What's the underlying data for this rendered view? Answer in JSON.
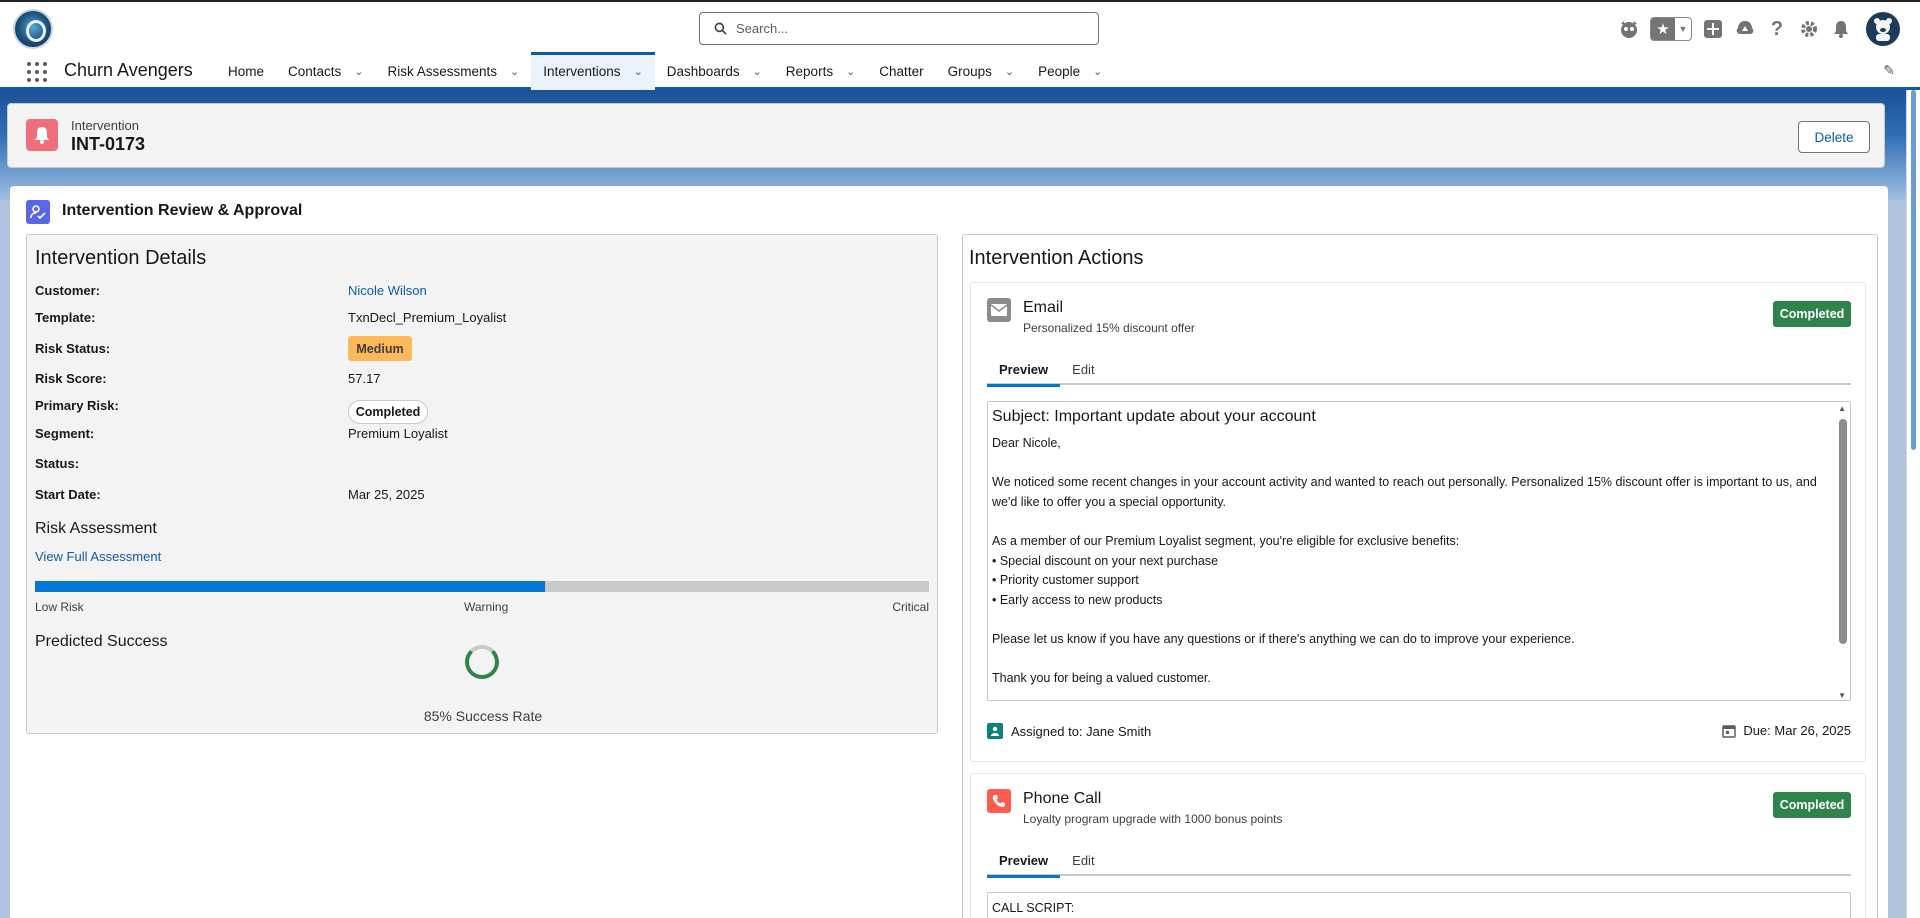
{
  "header": {
    "search_placeholder": "Search...",
    "icons": [
      "bot-icon",
      "favorites-star-icon",
      "add-icon",
      "trailhead-icon",
      "help-icon",
      "setup-gear-icon",
      "notifications-bell-icon",
      "avatar"
    ]
  },
  "nav": {
    "app_name": "Churn Avengers",
    "items": [
      {
        "label": "Home",
        "dropdown": false,
        "active": false
      },
      {
        "label": "Contacts",
        "dropdown": true,
        "active": false
      },
      {
        "label": "Risk Assessments",
        "dropdown": true,
        "active": false
      },
      {
        "label": "Interventions",
        "dropdown": true,
        "active": true
      },
      {
        "label": "Dashboards",
        "dropdown": true,
        "active": false
      },
      {
        "label": "Reports",
        "dropdown": true,
        "active": false
      },
      {
        "label": "Chatter",
        "dropdown": false,
        "active": false
      },
      {
        "label": "Groups",
        "dropdown": true,
        "active": false
      },
      {
        "label": "People",
        "dropdown": true,
        "active": false
      }
    ]
  },
  "record": {
    "type_label": "Intervention",
    "name": "INT-0173",
    "delete_label": "Delete"
  },
  "main": {
    "title": "Intervention Review & Approval"
  },
  "details": {
    "heading": "Intervention Details",
    "fields": {
      "customer_label": "Customer:",
      "customer_value": "Nicole Wilson",
      "template_label": "Template:",
      "template_value": "TxnDecl_Premium_Loyalist",
      "risk_status_label": "Risk Status:",
      "risk_status_value": "Medium",
      "risk_score_label": "Risk Score:",
      "risk_score_value": "57.17",
      "primary_risk_label": "Primary Risk:",
      "segment_label": "Segment:",
      "segment_value": "Premium Loyalist",
      "status_label": "Status:",
      "status_value": "Completed",
      "start_date_label": "Start Date:",
      "start_date_value": "Mar 25, 2025"
    },
    "risk_assessment_heading": "Risk Assessment",
    "view_assessment_link": "View Full Assessment",
    "risk_bar_fill_fraction": 0.57,
    "risk_labels": {
      "low": "Low Risk",
      "warning": "Warning",
      "critical": "Critical"
    },
    "predicted_success_heading": "Predicted Success",
    "success_rate_label": "85% Success Rate",
    "success_rate_fraction": 0.85
  },
  "actions": {
    "heading": "Intervention Actions",
    "email": {
      "title": "Email",
      "subtitle": "Personalized 15% discount offer",
      "status": "Completed",
      "tabs": [
        "Preview",
        "Edit"
      ],
      "subject": "Subject: Important update about your account",
      "body": "Dear Nicole,\n\nWe noticed some recent changes in your account activity and wanted to reach out personally. Personalized 15% discount offer is important to us, and we'd like to offer you a special opportunity.\n\nAs a member of our Premium Loyalist segment, you're eligible for exclusive benefits:\n• Special discount on your next purchase\n• Priority customer support\n• Early access to new products\n\nPlease let us know if you have any questions or if there's anything we can do to improve your experience.\n\nThank you for being a valued customer.",
      "assigned": "Assigned to: Jane Smith",
      "due": "Due: Mar 26, 2025"
    },
    "phone": {
      "title": "Phone Call",
      "subtitle": "Loyalty program upgrade with 1000 bonus points",
      "status": "Completed",
      "tabs": [
        "Preview",
        "Edit"
      ],
      "script_label": "CALL SCRIPT:"
    }
  },
  "colors": {
    "brand_blue": "#0b5cab",
    "completed_green": "#2e844a",
    "medium_orange": "#fcb95b",
    "intervention_pink": "#ef6e7c",
    "phone_orange": "#fe5c4c"
  }
}
